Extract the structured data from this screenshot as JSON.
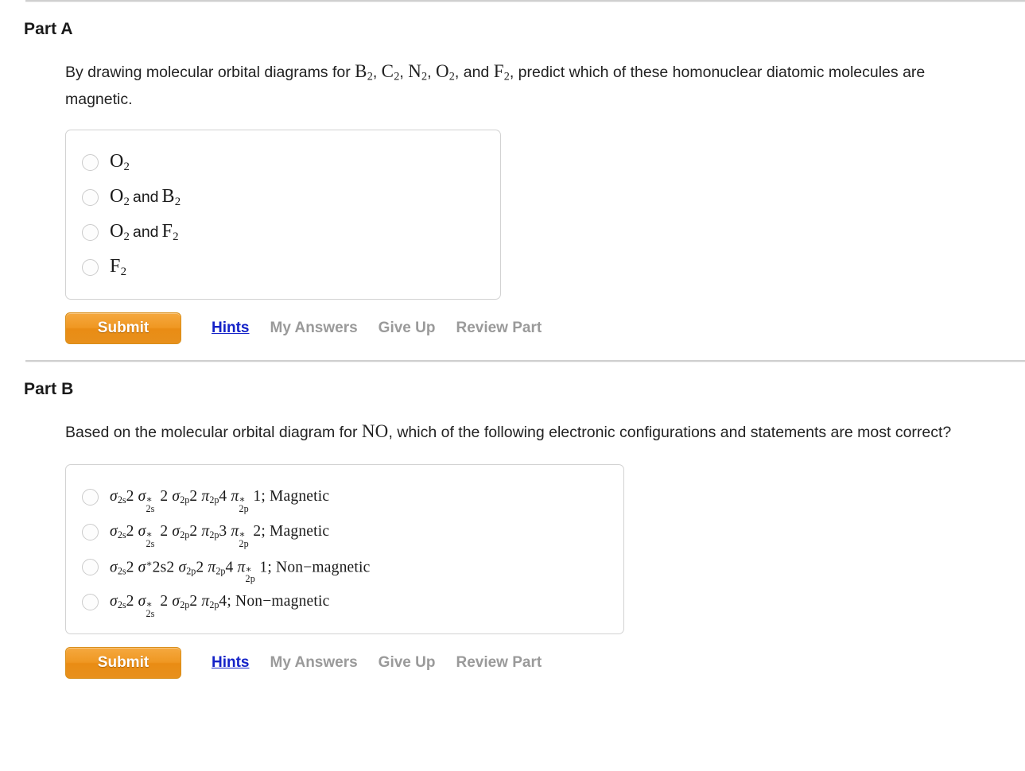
{
  "parts": [
    {
      "title": "Part A",
      "question_prefix": "By drawing molecular orbital diagrams for ",
      "question_suffix": ", predict which of these homonuclear diatomic molecules are magnetic.",
      "question_formulas": [
        "B2",
        "C2",
        "N2",
        "O2",
        "F2"
      ],
      "question_connector": ", and ",
      "options": [
        {
          "id": "a1",
          "text": "O2"
        },
        {
          "id": "a2",
          "text": "O2 and B2"
        },
        {
          "id": "a3",
          "text": "O2 and F2"
        },
        {
          "id": "a4",
          "text": "F2"
        }
      ],
      "actions": {
        "submit_label": "Submit",
        "links": [
          {
            "label": "Hints",
            "style": "primary"
          },
          {
            "label": "My Answers",
            "style": "muted"
          },
          {
            "label": "Give Up",
            "style": "muted"
          },
          {
            "label": "Review Part",
            "style": "muted"
          }
        ]
      }
    },
    {
      "title": "Part B",
      "question_prefix": "Based on the molecular orbital diagram for ",
      "question_formula": "NO",
      "question_suffix": ", which of the following electronic configurations and statements are most correct?",
      "options": [
        {
          "id": "b1",
          "text": "σ 2s 2 σ*2s 2 σ 2p 2 π 2p 4 π*2p 1; Magnetic"
        },
        {
          "id": "b2",
          "text": "σ 2s 2 σ*2s 2 σ 2p 2 π 2p 3 π*2p 2; Magnetic"
        },
        {
          "id": "b3",
          "text": "σ 2s 2 σ* 2s2 σ 2p 2 π 2p 4 π*2p 1; Non−magnetic"
        },
        {
          "id": "b4",
          "text": "σ 2s 2 σ*2s 2 σ 2p 2 π 2p 4; Non−magnetic"
        }
      ],
      "actions": {
        "submit_label": "Submit",
        "links": [
          {
            "label": "Hints",
            "style": "primary"
          },
          {
            "label": "My Answers",
            "style": "muted"
          },
          {
            "label": "Give Up",
            "style": "muted"
          },
          {
            "label": "Review Part",
            "style": "muted"
          }
        ]
      }
    }
  ],
  "partA": {
    "title": "Part A",
    "q_seg1": "By drawing molecular orbital diagrams for ",
    "q_f1": "B",
    "q_f1s": "2",
    "q_sep1": ", ",
    "q_f2": "C",
    "q_f2s": "2",
    "q_sep2": ", ",
    "q_f3": "N",
    "q_f3s": "2",
    "q_sep3": ", ",
    "q_f4": "O",
    "q_f4s": "2",
    "q_sep4": ", and ",
    "q_f5": "F",
    "q_f5s": "2",
    "q_seg2": ", predict which of these homonuclear diatomic molecules are magnetic.",
    "o1_e1": "O",
    "o1_s1": "2",
    "o2_e1": "O",
    "o2_s1": "2",
    "o2_and": "and",
    "o2_e2": "B",
    "o2_s2": "2",
    "o3_e1": "O",
    "o3_s1": "2",
    "o3_and": "and",
    "o3_e2": "F",
    "o3_s2": "2",
    "o4_e1": "F",
    "o4_s1": "2",
    "submit_label": "Submit",
    "link_hints": "Hints",
    "link_my_answers": "My Answers",
    "link_give_up": "Give Up",
    "link_review_part": "Review Part"
  },
  "partB": {
    "title": "Part B",
    "q_seg1": "Based on the molecular orbital diagram for ",
    "q_f1": "NO",
    "q_seg2": ", which of the following electronic configurations and statements are most correct?",
    "sigma": "σ",
    "pi": "π",
    "star": "∗",
    "sub_2s": "2s",
    "sub_2p": "2p",
    "o1_n1": "2",
    "o1_n2": "2",
    "o1_n3": "2",
    "o1_n4": "4",
    "o1_n5": "1",
    "o1_tail": "; Magnetic",
    "o2_n1": "2",
    "o2_n2": "2",
    "o2_n3": "2",
    "o2_n4": "3",
    "o2_n5": "2",
    "o2_tail": "; Magnetic",
    "o3_n1": "2",
    "o3_alt": "2s2",
    "o3_n3": "2",
    "o3_n4": "4",
    "o3_n5": "1",
    "o3_tail": "; Non−magnetic",
    "o4_n1": "2",
    "o4_n2": "2",
    "o4_n3": "2",
    "o4_n4": "4",
    "o4_tail": "; Non−magnetic",
    "submit_label": "Submit",
    "link_hints": "Hints",
    "link_my_answers": "My Answers",
    "link_give_up": "Give Up",
    "link_review_part": "Review Part"
  },
  "colors": {
    "accent_button": "#ef9722",
    "link_blue": "#1422c8",
    "muted_gray": "#9a9a9a",
    "divider_gray": "#cfcfcf",
    "box_border": "#d2d2d2"
  }
}
